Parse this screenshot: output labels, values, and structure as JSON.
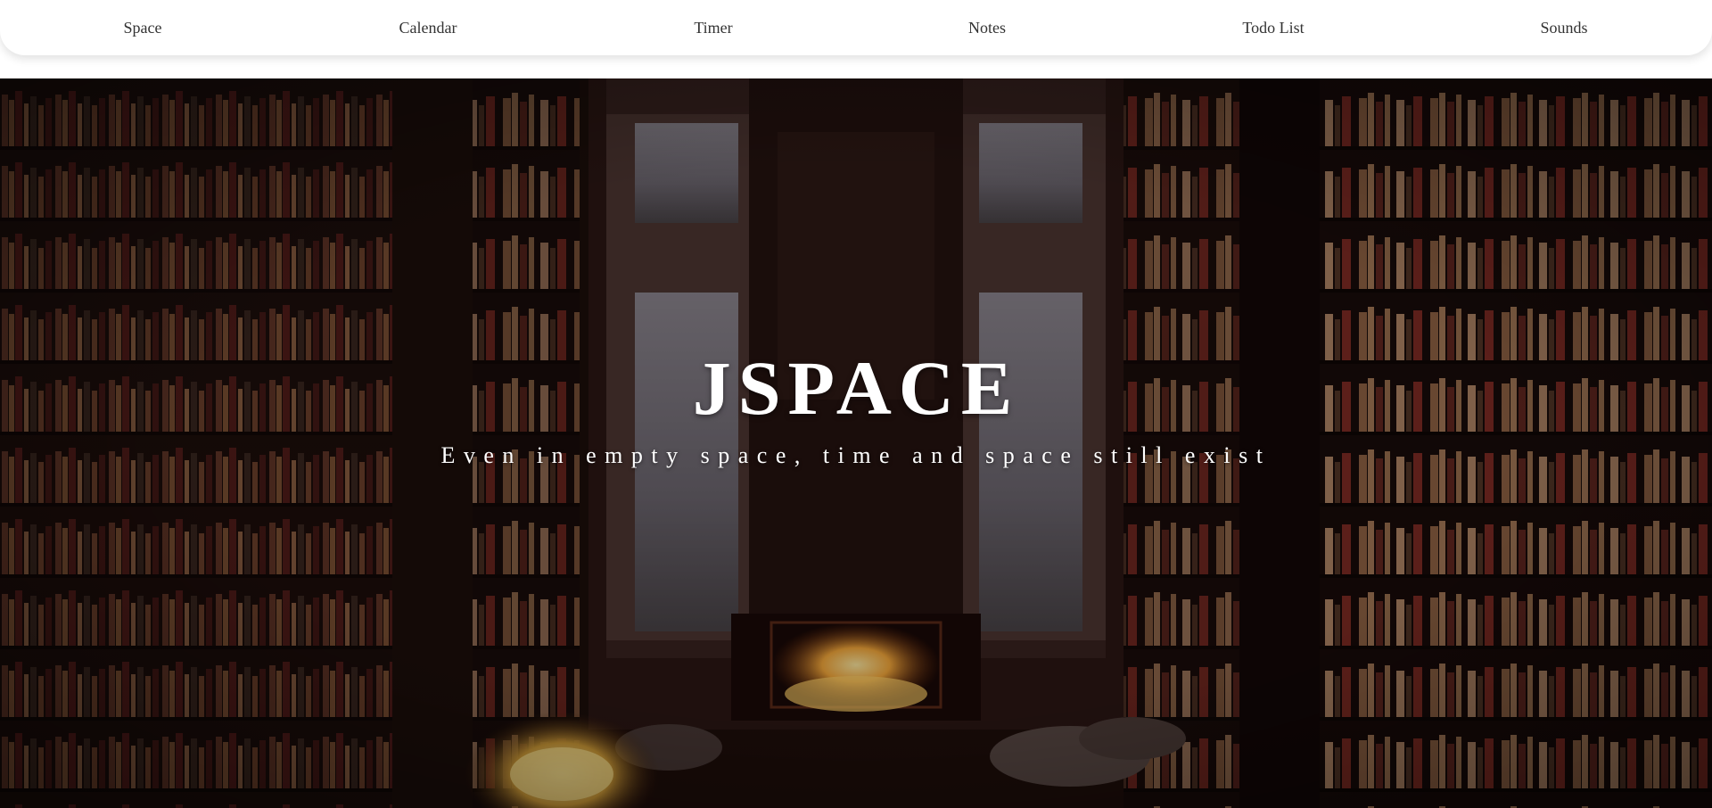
{
  "nav": {
    "items": [
      {
        "label": "Space"
      },
      {
        "label": "Calendar"
      },
      {
        "label": "Timer"
      },
      {
        "label": "Notes"
      },
      {
        "label": "Todo List"
      },
      {
        "label": "Sounds"
      }
    ]
  },
  "hero": {
    "title": "JSPACE",
    "subtitle": "Even in empty space, time and space still exist",
    "background": "library-fireplace-image"
  },
  "colors": {
    "nav_background": "#ffffff",
    "nav_text": "#333333",
    "hero_text": "#ffffff"
  }
}
